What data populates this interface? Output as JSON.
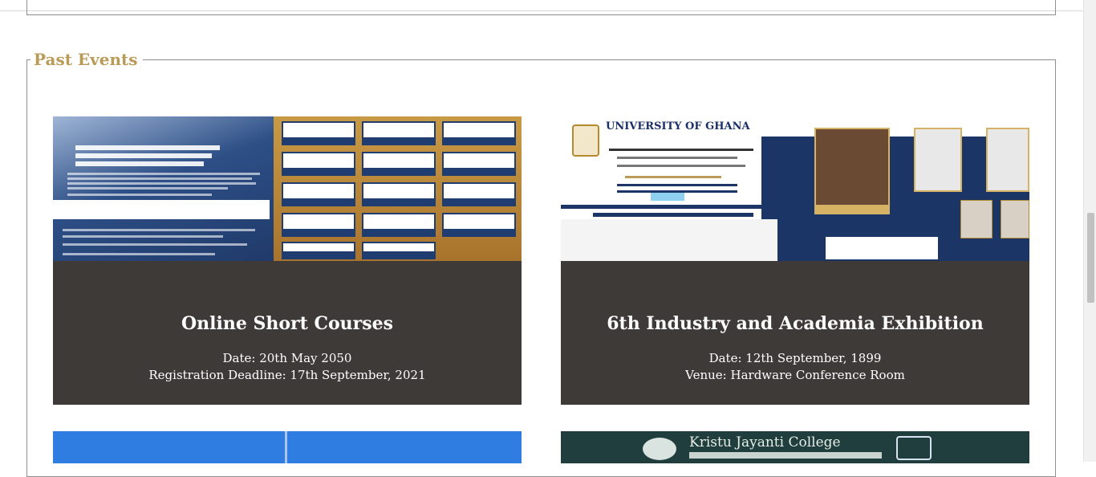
{
  "section": {
    "legend": "Past Events"
  },
  "events": [
    {
      "title": "Online Short Courses",
      "line1": "Date: 20th May 2050",
      "line2": "Registration Deadline: 17th September, 2021",
      "image": "poster-computer-science-short-courses"
    },
    {
      "title": "6th Industry and Academia Exhibition",
      "line1": "Date: 12th September, 1899",
      "line2": "Venue: Hardware Conference Room",
      "image": "poster-university-of-ghana",
      "poster_text": "UNIVERSITY OF GHANA"
    }
  ],
  "next_row": {
    "right_poster_text": "Kristu Jayanti College"
  },
  "colors": {
    "legend": "#b99a57",
    "card_background": "#3e3a37",
    "card_text": "#ffffff"
  }
}
